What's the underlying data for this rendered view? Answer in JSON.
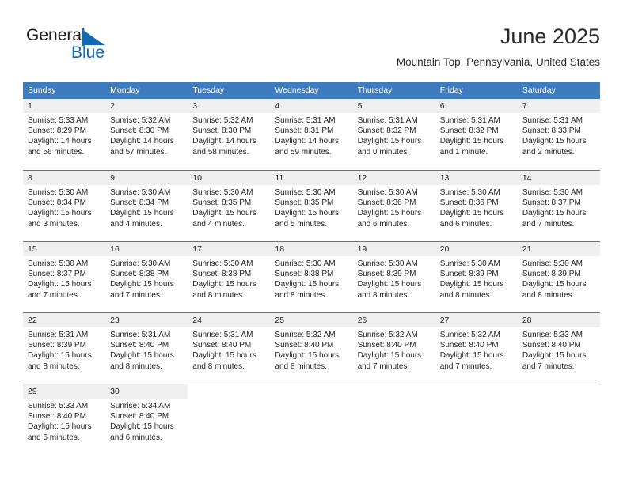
{
  "branding": {
    "logo_text_top": "General",
    "logo_text_bottom": "Blue",
    "logo_color": "#1268b3",
    "logo_icon": "sailboat-sail-icon"
  },
  "header": {
    "month_title": "June 2025",
    "location": "Mountain Top, Pennsylvania, United States"
  },
  "colors": {
    "header_row_bg": "#3d7cbf",
    "daynum_band_bg": "#efefef",
    "row_divider": "#3d7cbf",
    "text": "#222222"
  },
  "weekday_headers": [
    "Sunday",
    "Monday",
    "Tuesday",
    "Wednesday",
    "Thursday",
    "Friday",
    "Saturday"
  ],
  "weeks": [
    [
      {
        "day": "1",
        "sunrise": "Sunrise: 5:33 AM",
        "sunset": "Sunset: 8:29 PM",
        "daylight1": "Daylight: 14 hours",
        "daylight2": "and 56 minutes."
      },
      {
        "day": "2",
        "sunrise": "Sunrise: 5:32 AM",
        "sunset": "Sunset: 8:30 PM",
        "daylight1": "Daylight: 14 hours",
        "daylight2": "and 57 minutes."
      },
      {
        "day": "3",
        "sunrise": "Sunrise: 5:32 AM",
        "sunset": "Sunset: 8:30 PM",
        "daylight1": "Daylight: 14 hours",
        "daylight2": "and 58 minutes."
      },
      {
        "day": "4",
        "sunrise": "Sunrise: 5:31 AM",
        "sunset": "Sunset: 8:31 PM",
        "daylight1": "Daylight: 14 hours",
        "daylight2": "and 59 minutes."
      },
      {
        "day": "5",
        "sunrise": "Sunrise: 5:31 AM",
        "sunset": "Sunset: 8:32 PM",
        "daylight1": "Daylight: 15 hours",
        "daylight2": "and 0 minutes."
      },
      {
        "day": "6",
        "sunrise": "Sunrise: 5:31 AM",
        "sunset": "Sunset: 8:32 PM",
        "daylight1": "Daylight: 15 hours",
        "daylight2": "and 1 minute."
      },
      {
        "day": "7",
        "sunrise": "Sunrise: 5:31 AM",
        "sunset": "Sunset: 8:33 PM",
        "daylight1": "Daylight: 15 hours",
        "daylight2": "and 2 minutes."
      }
    ],
    [
      {
        "day": "8",
        "sunrise": "Sunrise: 5:30 AM",
        "sunset": "Sunset: 8:34 PM",
        "daylight1": "Daylight: 15 hours",
        "daylight2": "and 3 minutes."
      },
      {
        "day": "9",
        "sunrise": "Sunrise: 5:30 AM",
        "sunset": "Sunset: 8:34 PM",
        "daylight1": "Daylight: 15 hours",
        "daylight2": "and 4 minutes."
      },
      {
        "day": "10",
        "sunrise": "Sunrise: 5:30 AM",
        "sunset": "Sunset: 8:35 PM",
        "daylight1": "Daylight: 15 hours",
        "daylight2": "and 4 minutes."
      },
      {
        "day": "11",
        "sunrise": "Sunrise: 5:30 AM",
        "sunset": "Sunset: 8:35 PM",
        "daylight1": "Daylight: 15 hours",
        "daylight2": "and 5 minutes."
      },
      {
        "day": "12",
        "sunrise": "Sunrise: 5:30 AM",
        "sunset": "Sunset: 8:36 PM",
        "daylight1": "Daylight: 15 hours",
        "daylight2": "and 6 minutes."
      },
      {
        "day": "13",
        "sunrise": "Sunrise: 5:30 AM",
        "sunset": "Sunset: 8:36 PM",
        "daylight1": "Daylight: 15 hours",
        "daylight2": "and 6 minutes."
      },
      {
        "day": "14",
        "sunrise": "Sunrise: 5:30 AM",
        "sunset": "Sunset: 8:37 PM",
        "daylight1": "Daylight: 15 hours",
        "daylight2": "and 7 minutes."
      }
    ],
    [
      {
        "day": "15",
        "sunrise": "Sunrise: 5:30 AM",
        "sunset": "Sunset: 8:37 PM",
        "daylight1": "Daylight: 15 hours",
        "daylight2": "and 7 minutes."
      },
      {
        "day": "16",
        "sunrise": "Sunrise: 5:30 AM",
        "sunset": "Sunset: 8:38 PM",
        "daylight1": "Daylight: 15 hours",
        "daylight2": "and 7 minutes."
      },
      {
        "day": "17",
        "sunrise": "Sunrise: 5:30 AM",
        "sunset": "Sunset: 8:38 PM",
        "daylight1": "Daylight: 15 hours",
        "daylight2": "and 8 minutes."
      },
      {
        "day": "18",
        "sunrise": "Sunrise: 5:30 AM",
        "sunset": "Sunset: 8:38 PM",
        "daylight1": "Daylight: 15 hours",
        "daylight2": "and 8 minutes."
      },
      {
        "day": "19",
        "sunrise": "Sunrise: 5:30 AM",
        "sunset": "Sunset: 8:39 PM",
        "daylight1": "Daylight: 15 hours",
        "daylight2": "and 8 minutes."
      },
      {
        "day": "20",
        "sunrise": "Sunrise: 5:30 AM",
        "sunset": "Sunset: 8:39 PM",
        "daylight1": "Daylight: 15 hours",
        "daylight2": "and 8 minutes."
      },
      {
        "day": "21",
        "sunrise": "Sunrise: 5:30 AM",
        "sunset": "Sunset: 8:39 PM",
        "daylight1": "Daylight: 15 hours",
        "daylight2": "and 8 minutes."
      }
    ],
    [
      {
        "day": "22",
        "sunrise": "Sunrise: 5:31 AM",
        "sunset": "Sunset: 8:39 PM",
        "daylight1": "Daylight: 15 hours",
        "daylight2": "and 8 minutes."
      },
      {
        "day": "23",
        "sunrise": "Sunrise: 5:31 AM",
        "sunset": "Sunset: 8:40 PM",
        "daylight1": "Daylight: 15 hours",
        "daylight2": "and 8 minutes."
      },
      {
        "day": "24",
        "sunrise": "Sunrise: 5:31 AM",
        "sunset": "Sunset: 8:40 PM",
        "daylight1": "Daylight: 15 hours",
        "daylight2": "and 8 minutes."
      },
      {
        "day": "25",
        "sunrise": "Sunrise: 5:32 AM",
        "sunset": "Sunset: 8:40 PM",
        "daylight1": "Daylight: 15 hours",
        "daylight2": "and 8 minutes."
      },
      {
        "day": "26",
        "sunrise": "Sunrise: 5:32 AM",
        "sunset": "Sunset: 8:40 PM",
        "daylight1": "Daylight: 15 hours",
        "daylight2": "and 7 minutes."
      },
      {
        "day": "27",
        "sunrise": "Sunrise: 5:32 AM",
        "sunset": "Sunset: 8:40 PM",
        "daylight1": "Daylight: 15 hours",
        "daylight2": "and 7 minutes."
      },
      {
        "day": "28",
        "sunrise": "Sunrise: 5:33 AM",
        "sunset": "Sunset: 8:40 PM",
        "daylight1": "Daylight: 15 hours",
        "daylight2": "and 7 minutes."
      }
    ],
    [
      {
        "day": "29",
        "sunrise": "Sunrise: 5:33 AM",
        "sunset": "Sunset: 8:40 PM",
        "daylight1": "Daylight: 15 hours",
        "daylight2": "and 6 minutes."
      },
      {
        "day": "30",
        "sunrise": "Sunrise: 5:34 AM",
        "sunset": "Sunset: 8:40 PM",
        "daylight1": "Daylight: 15 hours",
        "daylight2": "and 6 minutes."
      },
      {
        "day": "",
        "sunrise": "",
        "sunset": "",
        "daylight1": "",
        "daylight2": ""
      },
      {
        "day": "",
        "sunrise": "",
        "sunset": "",
        "daylight1": "",
        "daylight2": ""
      },
      {
        "day": "",
        "sunrise": "",
        "sunset": "",
        "daylight1": "",
        "daylight2": ""
      },
      {
        "day": "",
        "sunrise": "",
        "sunset": "",
        "daylight1": "",
        "daylight2": ""
      },
      {
        "day": "",
        "sunrise": "",
        "sunset": "",
        "daylight1": "",
        "daylight2": ""
      }
    ]
  ]
}
